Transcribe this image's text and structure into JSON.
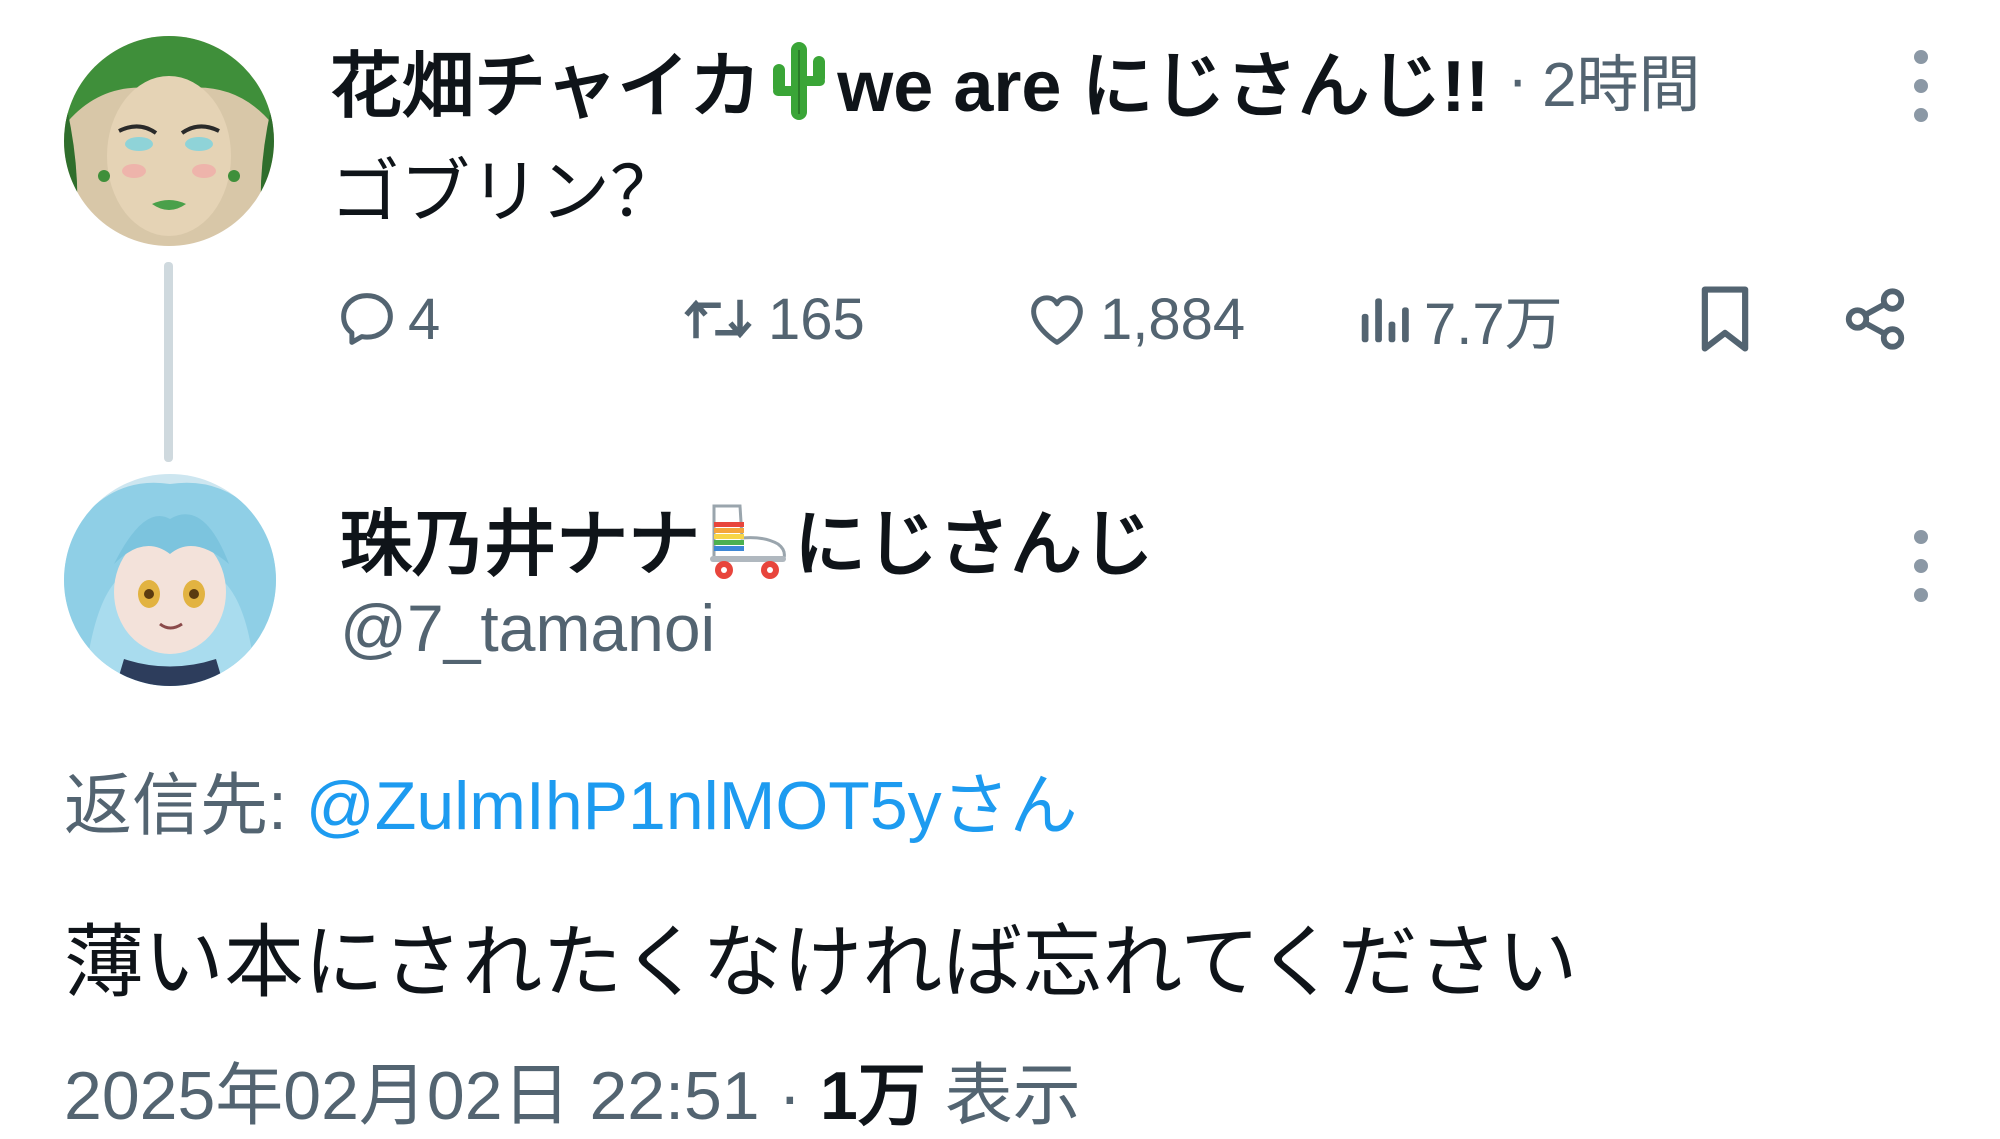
{
  "tweet1": {
    "author_name_part1": "花畑チャイカ",
    "author_emoji": "cactus",
    "author_name_part2": "we are にじさんじ!!",
    "separator": "·",
    "time": "2時間",
    "text": "ゴブリン？",
    "actions": {
      "reply_icon": "reply-icon",
      "reply_count": "4",
      "retweet_icon": "retweet-icon",
      "retweet_count": "165",
      "like_icon": "heart-icon",
      "like_count": "1,884",
      "views_icon": "views-chart-icon",
      "views_count": "7.7万",
      "bookmark_icon": "bookmark-icon",
      "share_icon": "share-icon"
    },
    "menu_icon": "more-vertical-icon"
  },
  "tweet2": {
    "author_name_part1": "珠乃井ナナ",
    "author_emoji": "roller-skate",
    "author_name_part2": "にじさんじ",
    "handle": "@7_tamanoi",
    "reply_label": "返信先: ",
    "reply_target": "@ZulmIhP1nlMOT5yさん",
    "text": "薄い本にされたくなければ忘れてください",
    "timestamp": "2025年02月02日 22:51",
    "separator": " · ",
    "views_count": "1万",
    "views_label": " 表示",
    "menu_icon": "more-vertical-icon"
  },
  "colors": {
    "text_primary": "#0f1419",
    "text_secondary": "#536471",
    "link": "#1d9bf0",
    "thread_line": "#cfd9de"
  }
}
